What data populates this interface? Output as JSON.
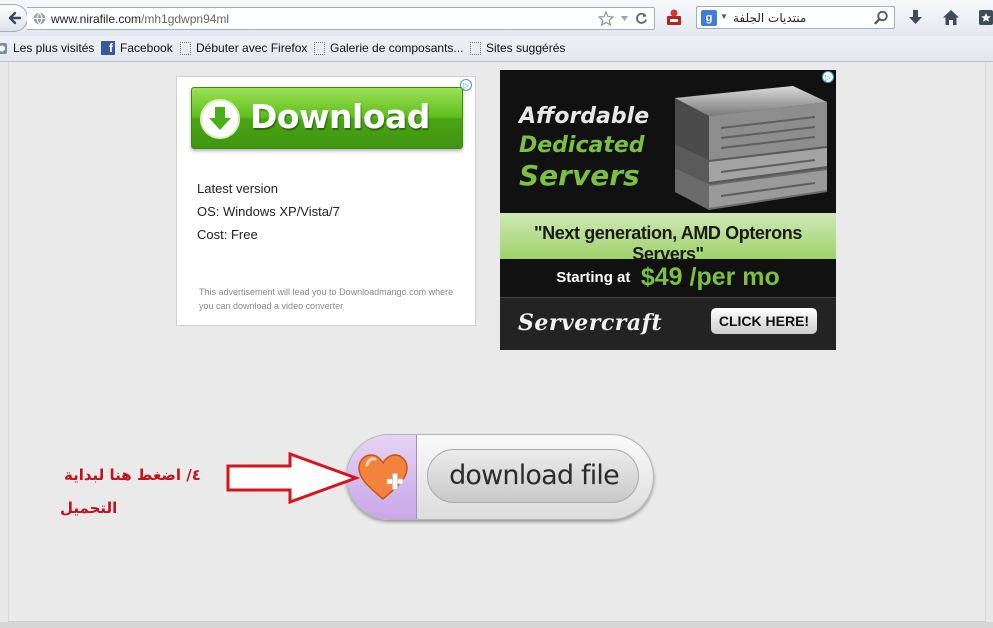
{
  "browser": {
    "url": {
      "host": "www.nirafile.com",
      "path": "/mh1gdwpn94ml"
    },
    "search": {
      "engine": "g",
      "query": "منتديات الجلفة"
    },
    "bookmarks": [
      "Les plus visités",
      "Facebook",
      "Débuter avec Firefox",
      "Galerie de composants...",
      "Sites suggérés"
    ]
  },
  "ad_left": {
    "button_label": "Download",
    "info_lines": [
      "Latest version",
      "OS: Windows XP/Vista/7",
      "Cost: Free"
    ],
    "note": "This advertisement will lead you to Downloadmango.com where you can download a video converter"
  },
  "ad_right": {
    "headline": [
      "Affordable",
      "Dedicated",
      "Servers"
    ],
    "tagline": "\"Next generation, AMD Opterons Servers\"",
    "price_prefix": "Starting at",
    "price": "$49 /per mo",
    "brand": "Servercraft",
    "cta": "CLICK HERE!"
  },
  "download_button": {
    "label": "download file"
  },
  "annotation": {
    "line1": "٤/ اضغط هنا لبداية",
    "line2": "التحميل"
  },
  "colors": {
    "annotation": "#c2121c",
    "ad_green": "#7bc043",
    "download_green": "#4caf1a"
  }
}
